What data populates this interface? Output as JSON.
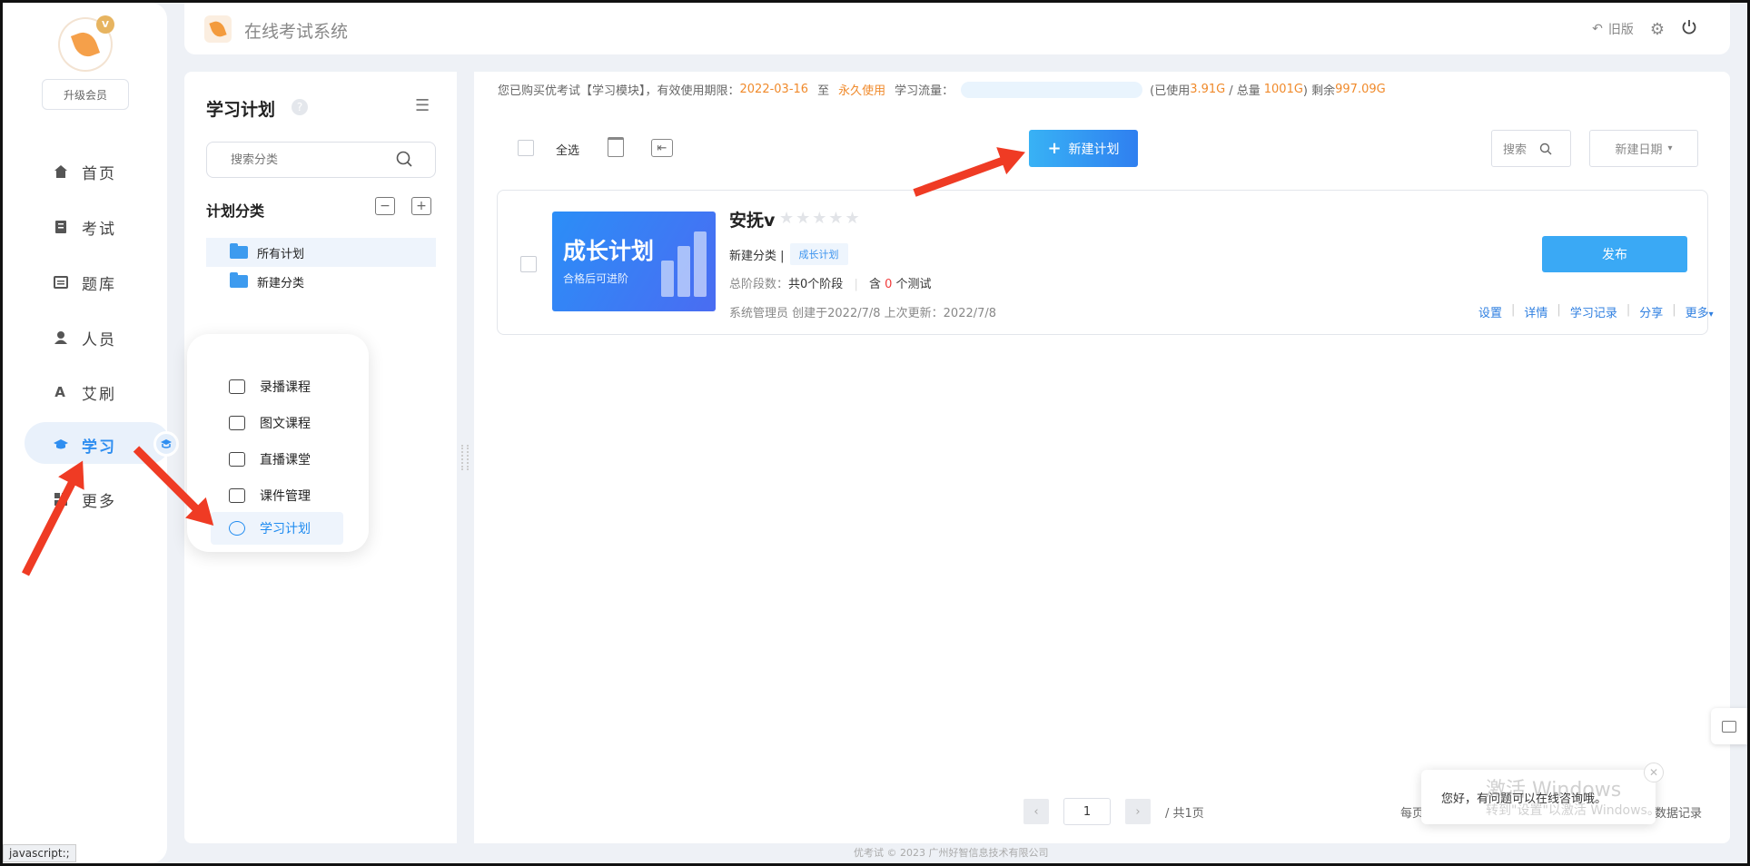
{
  "app": {
    "title": "在线考试系统",
    "upgrade_label": "升级会员",
    "vip_badge": "V"
  },
  "topbar": {
    "old_version": "旧版"
  },
  "nav": {
    "items": [
      {
        "label": "首页",
        "icon": "home-icon"
      },
      {
        "label": "考试",
        "icon": "exam-icon"
      },
      {
        "label": "题库",
        "icon": "question-bank-icon"
      },
      {
        "label": "人员",
        "icon": "user-icon"
      },
      {
        "label": "艾刷",
        "icon": "font-icon"
      },
      {
        "label": "学习",
        "icon": "graduation-cap-icon"
      },
      {
        "label": "更多",
        "icon": "grid-icon"
      }
    ],
    "active_index": 5
  },
  "submenu": {
    "items": [
      {
        "label": "录播课程"
      },
      {
        "label": "图文课程"
      },
      {
        "label": "直播课堂"
      },
      {
        "label": "课件管理"
      },
      {
        "label": "学习计划"
      }
    ],
    "active_index": 4
  },
  "category": {
    "title": "学习计划",
    "search_placeholder": "搜索分类",
    "section_title": "计划分类",
    "tree": [
      {
        "label": "所有计划",
        "active": true
      },
      {
        "label": "新建分类",
        "active": false
      }
    ]
  },
  "notice": {
    "prefix": "您已购买优考试【学习模块】，有效使用期限：",
    "start": "2022-03-16",
    "to": "至",
    "end": "永久使用",
    "traffic_label": "学习流量：",
    "used_prefix": "(已使用",
    "used": "3.91G",
    "total_prefix": "/ 总量",
    "total": "1001G",
    "remain_prefix": ") 剩余",
    "remain": "997.09G"
  },
  "toolbar": {
    "select_all": "全选",
    "new_plan": "新建计划",
    "search_label": "搜索",
    "sort_label": "新建日期"
  },
  "plan": {
    "name": "安抚v",
    "stars": "★★★★★",
    "cover_title": "成长计划",
    "cover_subtitle": "合格后可进阶",
    "category": "新建分类 |",
    "tag": "成长计划",
    "stages_label": "总阶段数：",
    "stages_value": "共0个阶段",
    "test_prefix": "含",
    "test_count": "0",
    "test_suffix": "个测试",
    "meta": "系统管理员  创建于2022/7/8   上次更新：2022/7/8",
    "publish": "发布",
    "links": [
      "设置",
      "详情",
      "学习记录",
      "分享",
      "更多"
    ]
  },
  "pager": {
    "page": "1",
    "total_pages": "/ 共1页",
    "per_page": "每页",
    "records": "数据记录"
  },
  "chat": {
    "message": "您好，有问题可以在线咨询哦。",
    "close": "✕"
  },
  "watermark": {
    "title": "激活 Windows",
    "hint": "转到\"设置\"以激活 Windows。"
  },
  "footer": {
    "copyright": "优考试 © 2023 广州好智信息技术有限公司"
  },
  "statusbar": {
    "text": "javascript:;"
  },
  "colors": {
    "primary": "#3aa9f5",
    "accent_orange": "#f08a2b",
    "arrow_red": "#ef3b24"
  }
}
